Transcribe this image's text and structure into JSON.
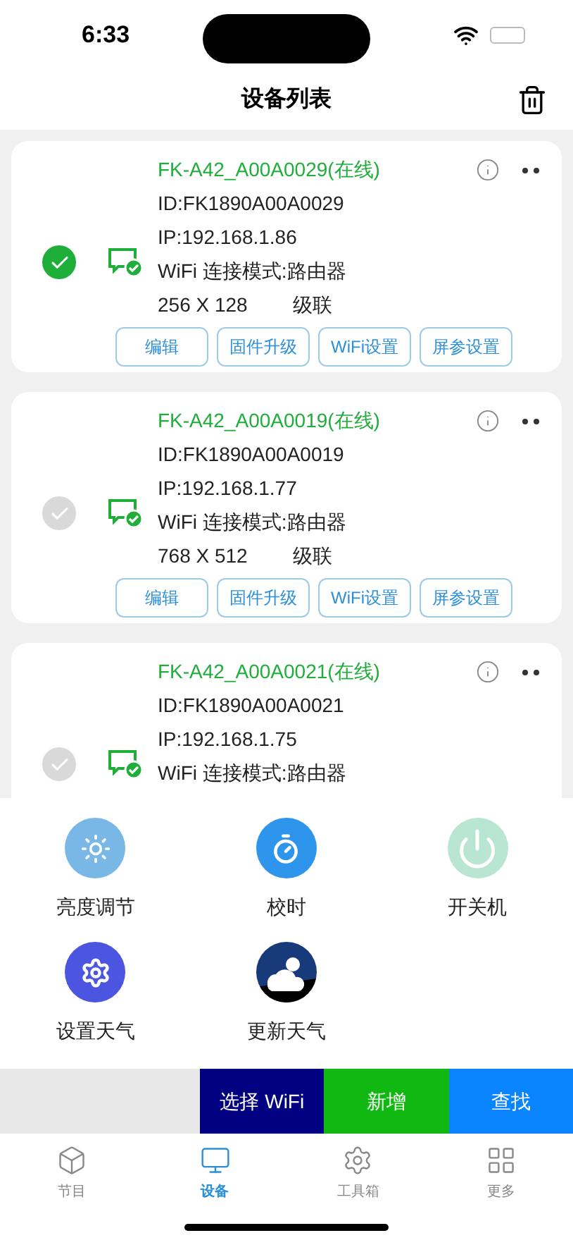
{
  "status_bar": {
    "time": "6:33"
  },
  "header": {
    "title": "设备列表"
  },
  "devices": [
    {
      "name": "FK-A42_A00A0029(在线)",
      "id": "ID:FK1890A00A0029",
      "ip": "IP:192.168.1.86",
      "wifi_mode": "WiFi 连接模式:路由器",
      "resolution": "256 X 128",
      "cascade": "级联",
      "selected": true,
      "buttons": [
        "编辑",
        "固件升级",
        "WiFi设置",
        "屏参设置"
      ]
    },
    {
      "name": "FK-A42_A00A0019(在线)",
      "id": "ID:FK1890A00A0019",
      "ip": "IP:192.168.1.77",
      "wifi_mode": "WiFi 连接模式:路由器",
      "resolution": "768 X 512",
      "cascade": "级联",
      "selected": false,
      "buttons": [
        "编辑",
        "固件升级",
        "WiFi设置",
        "屏参设置"
      ]
    },
    {
      "name": "FK-A42_A00A0021(在线)",
      "id": "ID:FK1890A00A0021",
      "ip": "IP:192.168.1.75",
      "wifi_mode": "WiFi 连接模式:路由器",
      "selected": false
    }
  ],
  "actions": [
    {
      "kind": "brightness",
      "label": "亮度调节"
    },
    {
      "kind": "timer",
      "label": "校时"
    },
    {
      "kind": "power",
      "label": "开关机"
    },
    {
      "kind": "settings",
      "label": "设置天气"
    },
    {
      "kind": "weather",
      "label": "更新天气"
    }
  ],
  "bottom_buttons": [
    {
      "kind": "wifi",
      "label": "选择 WiFi"
    },
    {
      "kind": "add",
      "label": "新增"
    },
    {
      "kind": "find",
      "label": "查找"
    }
  ],
  "tabs": [
    {
      "kind": "box",
      "label": "节目",
      "selected": false
    },
    {
      "kind": "monitor",
      "label": "设备",
      "selected": true
    },
    {
      "kind": "gear",
      "label": "工具箱",
      "selected": false
    },
    {
      "kind": "grid",
      "label": "更多",
      "selected": false
    }
  ]
}
